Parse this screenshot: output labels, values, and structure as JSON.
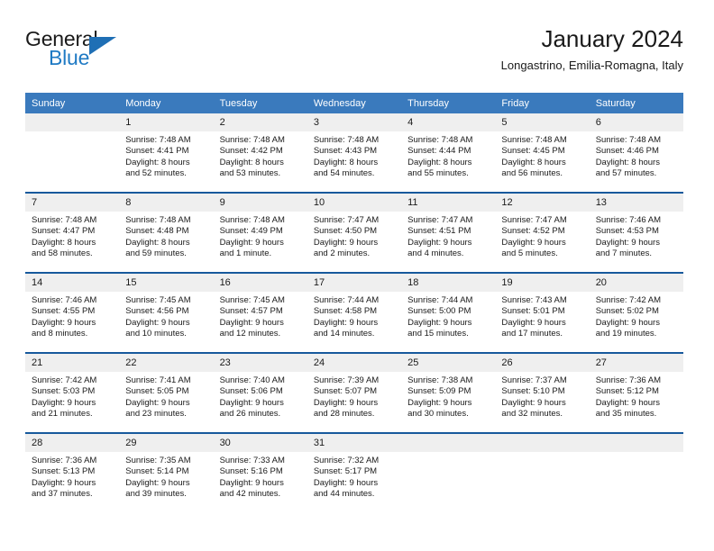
{
  "brand": {
    "name_part1": "General",
    "name_part2": "Blue",
    "triangle_icon": "triangle-icon"
  },
  "header": {
    "title": "January 2024",
    "subtitle": "Longastrino, Emilia-Romagna, Italy"
  },
  "colors": {
    "header_bar": "#3a7abd",
    "row_separator": "#17599c",
    "daynum_band": "#efefef",
    "brand_blue": "#1f7ac4",
    "text": "#1a1a1a"
  },
  "weekday_headers": [
    "Sunday",
    "Monday",
    "Tuesday",
    "Wednesday",
    "Thursday",
    "Friday",
    "Saturday"
  ],
  "weeks": [
    [
      {
        "day": "",
        "empty": true
      },
      {
        "day": "1",
        "sunrise": "Sunrise: 7:48 AM",
        "sunset": "Sunset: 4:41 PM",
        "daylight_line1": "Daylight: 8 hours",
        "daylight_line2": "and 52 minutes."
      },
      {
        "day": "2",
        "sunrise": "Sunrise: 7:48 AM",
        "sunset": "Sunset: 4:42 PM",
        "daylight_line1": "Daylight: 8 hours",
        "daylight_line2": "and 53 minutes."
      },
      {
        "day": "3",
        "sunrise": "Sunrise: 7:48 AM",
        "sunset": "Sunset: 4:43 PM",
        "daylight_line1": "Daylight: 8 hours",
        "daylight_line2": "and 54 minutes."
      },
      {
        "day": "4",
        "sunrise": "Sunrise: 7:48 AM",
        "sunset": "Sunset: 4:44 PM",
        "daylight_line1": "Daylight: 8 hours",
        "daylight_line2": "and 55 minutes."
      },
      {
        "day": "5",
        "sunrise": "Sunrise: 7:48 AM",
        "sunset": "Sunset: 4:45 PM",
        "daylight_line1": "Daylight: 8 hours",
        "daylight_line2": "and 56 minutes."
      },
      {
        "day": "6",
        "sunrise": "Sunrise: 7:48 AM",
        "sunset": "Sunset: 4:46 PM",
        "daylight_line1": "Daylight: 8 hours",
        "daylight_line2": "and 57 minutes."
      }
    ],
    [
      {
        "day": "7",
        "sunrise": "Sunrise: 7:48 AM",
        "sunset": "Sunset: 4:47 PM",
        "daylight_line1": "Daylight: 8 hours",
        "daylight_line2": "and 58 minutes."
      },
      {
        "day": "8",
        "sunrise": "Sunrise: 7:48 AM",
        "sunset": "Sunset: 4:48 PM",
        "daylight_line1": "Daylight: 8 hours",
        "daylight_line2": "and 59 minutes."
      },
      {
        "day": "9",
        "sunrise": "Sunrise: 7:48 AM",
        "sunset": "Sunset: 4:49 PM",
        "daylight_line1": "Daylight: 9 hours",
        "daylight_line2": "and 1 minute."
      },
      {
        "day": "10",
        "sunrise": "Sunrise: 7:47 AM",
        "sunset": "Sunset: 4:50 PM",
        "daylight_line1": "Daylight: 9 hours",
        "daylight_line2": "and 2 minutes."
      },
      {
        "day": "11",
        "sunrise": "Sunrise: 7:47 AM",
        "sunset": "Sunset: 4:51 PM",
        "daylight_line1": "Daylight: 9 hours",
        "daylight_line2": "and 4 minutes."
      },
      {
        "day": "12",
        "sunrise": "Sunrise: 7:47 AM",
        "sunset": "Sunset: 4:52 PM",
        "daylight_line1": "Daylight: 9 hours",
        "daylight_line2": "and 5 minutes."
      },
      {
        "day": "13",
        "sunrise": "Sunrise: 7:46 AM",
        "sunset": "Sunset: 4:53 PM",
        "daylight_line1": "Daylight: 9 hours",
        "daylight_line2": "and 7 minutes."
      }
    ],
    [
      {
        "day": "14",
        "sunrise": "Sunrise: 7:46 AM",
        "sunset": "Sunset: 4:55 PM",
        "daylight_line1": "Daylight: 9 hours",
        "daylight_line2": "and 8 minutes."
      },
      {
        "day": "15",
        "sunrise": "Sunrise: 7:45 AM",
        "sunset": "Sunset: 4:56 PM",
        "daylight_line1": "Daylight: 9 hours",
        "daylight_line2": "and 10 minutes."
      },
      {
        "day": "16",
        "sunrise": "Sunrise: 7:45 AM",
        "sunset": "Sunset: 4:57 PM",
        "daylight_line1": "Daylight: 9 hours",
        "daylight_line2": "and 12 minutes."
      },
      {
        "day": "17",
        "sunrise": "Sunrise: 7:44 AM",
        "sunset": "Sunset: 4:58 PM",
        "daylight_line1": "Daylight: 9 hours",
        "daylight_line2": "and 14 minutes."
      },
      {
        "day": "18",
        "sunrise": "Sunrise: 7:44 AM",
        "sunset": "Sunset: 5:00 PM",
        "daylight_line1": "Daylight: 9 hours",
        "daylight_line2": "and 15 minutes."
      },
      {
        "day": "19",
        "sunrise": "Sunrise: 7:43 AM",
        "sunset": "Sunset: 5:01 PM",
        "daylight_line1": "Daylight: 9 hours",
        "daylight_line2": "and 17 minutes."
      },
      {
        "day": "20",
        "sunrise": "Sunrise: 7:42 AM",
        "sunset": "Sunset: 5:02 PM",
        "daylight_line1": "Daylight: 9 hours",
        "daylight_line2": "and 19 minutes."
      }
    ],
    [
      {
        "day": "21",
        "sunrise": "Sunrise: 7:42 AM",
        "sunset": "Sunset: 5:03 PM",
        "daylight_line1": "Daylight: 9 hours",
        "daylight_line2": "and 21 minutes."
      },
      {
        "day": "22",
        "sunrise": "Sunrise: 7:41 AM",
        "sunset": "Sunset: 5:05 PM",
        "daylight_line1": "Daylight: 9 hours",
        "daylight_line2": "and 23 minutes."
      },
      {
        "day": "23",
        "sunrise": "Sunrise: 7:40 AM",
        "sunset": "Sunset: 5:06 PM",
        "daylight_line1": "Daylight: 9 hours",
        "daylight_line2": "and 26 minutes."
      },
      {
        "day": "24",
        "sunrise": "Sunrise: 7:39 AM",
        "sunset": "Sunset: 5:07 PM",
        "daylight_line1": "Daylight: 9 hours",
        "daylight_line2": "and 28 minutes."
      },
      {
        "day": "25",
        "sunrise": "Sunrise: 7:38 AM",
        "sunset": "Sunset: 5:09 PM",
        "daylight_line1": "Daylight: 9 hours",
        "daylight_line2": "and 30 minutes."
      },
      {
        "day": "26",
        "sunrise": "Sunrise: 7:37 AM",
        "sunset": "Sunset: 5:10 PM",
        "daylight_line1": "Daylight: 9 hours",
        "daylight_line2": "and 32 minutes."
      },
      {
        "day": "27",
        "sunrise": "Sunrise: 7:36 AM",
        "sunset": "Sunset: 5:12 PM",
        "daylight_line1": "Daylight: 9 hours",
        "daylight_line2": "and 35 minutes."
      }
    ],
    [
      {
        "day": "28",
        "sunrise": "Sunrise: 7:36 AM",
        "sunset": "Sunset: 5:13 PM",
        "daylight_line1": "Daylight: 9 hours",
        "daylight_line2": "and 37 minutes."
      },
      {
        "day": "29",
        "sunrise": "Sunrise: 7:35 AM",
        "sunset": "Sunset: 5:14 PM",
        "daylight_line1": "Daylight: 9 hours",
        "daylight_line2": "and 39 minutes."
      },
      {
        "day": "30",
        "sunrise": "Sunrise: 7:33 AM",
        "sunset": "Sunset: 5:16 PM",
        "daylight_line1": "Daylight: 9 hours",
        "daylight_line2": "and 42 minutes."
      },
      {
        "day": "31",
        "sunrise": "Sunrise: 7:32 AM",
        "sunset": "Sunset: 5:17 PM",
        "daylight_line1": "Daylight: 9 hours",
        "daylight_line2": "and 44 minutes."
      },
      {
        "day": "",
        "empty": true
      },
      {
        "day": "",
        "empty": true
      },
      {
        "day": "",
        "empty": true
      }
    ]
  ]
}
